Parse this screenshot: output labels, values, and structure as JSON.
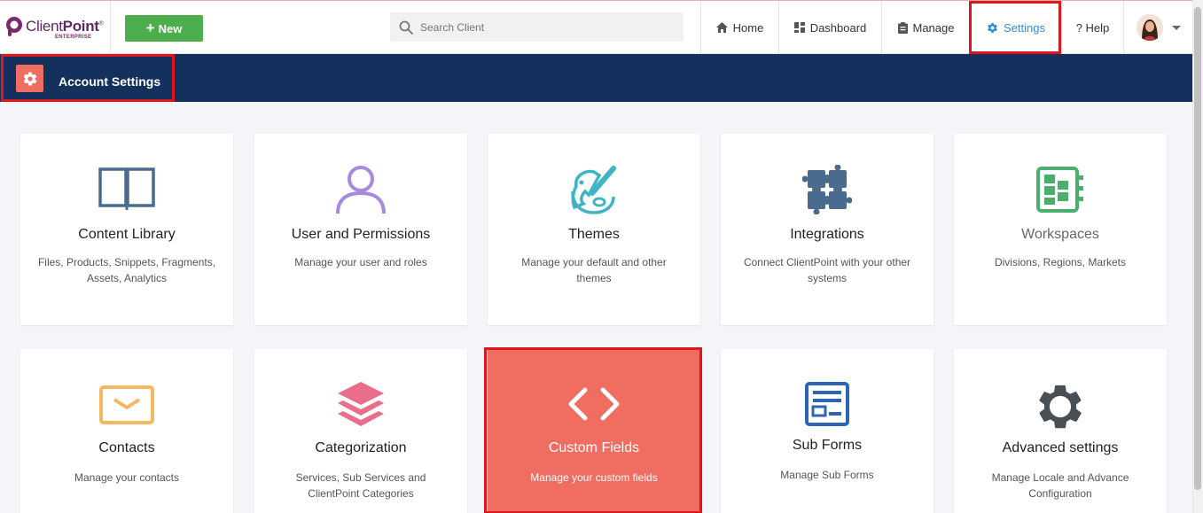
{
  "brand": {
    "name_light": "Client",
    "name_bold": "Point",
    "registered": "®",
    "edition": "ENTERPRISE"
  },
  "toolbar": {
    "new_label": "New"
  },
  "search": {
    "placeholder": "Search Client"
  },
  "nav": {
    "home": "Home",
    "dashboard": "Dashboard",
    "manage": "Manage",
    "settings": "Settings",
    "help": "? Help"
  },
  "header": {
    "title": "Account Settings"
  },
  "colors": {
    "accent": "#ef6d61",
    "band": "#14305c",
    "new_button": "#4cae4c",
    "active_nav": "#2f8fd8",
    "highlight": "#e0161d"
  },
  "cards": [
    {
      "icon": "book-icon",
      "title": "Content Library",
      "desc1": "Files, Products, Snippets, Fragments,",
      "desc2": "Assets, Analytics"
    },
    {
      "icon": "user-icon",
      "title": "User and Permissions",
      "desc1": "Manage your user and roles",
      "desc2": ""
    },
    {
      "icon": "palette-icon",
      "title": "Themes",
      "desc1": "Manage your default and other",
      "desc2": "themes"
    },
    {
      "icon": "puzzle-icon",
      "title": "Integrations",
      "desc1": "Connect ClientPoint with your other",
      "desc2": "systems"
    },
    {
      "icon": "workspaces-icon",
      "title": "Workspaces",
      "desc1": "Divisions, Regions, Markets",
      "desc2": ""
    },
    {
      "icon": "envelope-icon",
      "title": "Contacts",
      "desc1": "Manage your contacts",
      "desc2": ""
    },
    {
      "icon": "layers-icon",
      "title": "Categorization",
      "desc1": "Services, Sub Services and",
      "desc2": "ClientPoint Categories"
    },
    {
      "icon": "code-icon",
      "title": "Custom Fields",
      "desc1": "Manage your custom fields",
      "desc2": ""
    },
    {
      "icon": "form-icon",
      "title": "Sub Forms",
      "desc1": "Manage Sub Forms",
      "desc2": ""
    },
    {
      "icon": "gear-icon",
      "title": "Advanced settings",
      "desc1": "Manage Locale and Advance",
      "desc2": "Configuration"
    }
  ]
}
